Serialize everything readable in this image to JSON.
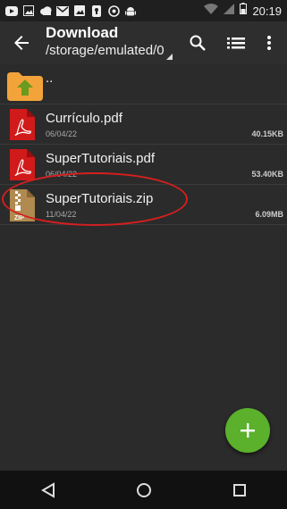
{
  "status_bar": {
    "time": "20:19",
    "left_icons": [
      "youtube-icon",
      "image-icon",
      "cloud-icon",
      "gmail-icon",
      "gallery-icon",
      "keyhole-icon",
      "whatsapp-icon",
      "android-icon"
    ],
    "right_icons": [
      "wifi-icon",
      "signal-icon",
      "battery-icon"
    ]
  },
  "app_bar": {
    "title": "Download",
    "path": "/storage/emulated/0",
    "actions": [
      "search-icon",
      "list-view-icon",
      "more-vert-icon"
    ]
  },
  "files": [
    {
      "name": "..",
      "type": "parent-folder",
      "date": "",
      "size": ""
    },
    {
      "name": "Currículo.pdf",
      "type": "pdf",
      "date": "06/04/22",
      "size": "40.15KB"
    },
    {
      "name": "SuperTutoriais.pdf",
      "type": "pdf",
      "date": "06/04/22",
      "size": "53.40KB"
    },
    {
      "name": "SuperTutoriais.zip",
      "type": "zip",
      "date": "11/04/22",
      "size": "6.09MB",
      "highlighted": true
    }
  ],
  "zip_icon_label": "ZIP",
  "colors": {
    "background": "#2b2b2b",
    "app_bar": "#2e2e2e",
    "fab": "#5bb02c",
    "pdf_red": "#d11a1a",
    "folder_orange": "#f2a43a",
    "annotation": "#d61f1f"
  }
}
